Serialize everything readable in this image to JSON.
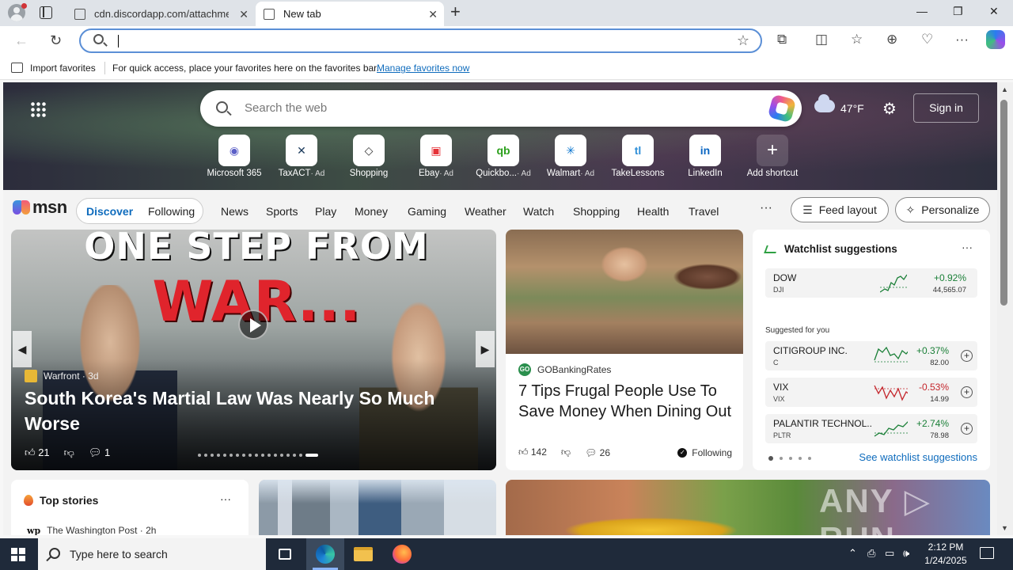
{
  "browser": {
    "tabs": [
      {
        "title": "cdn.discordapp.com/attachment"
      },
      {
        "title": "New tab"
      }
    ],
    "address": {
      "value": "",
      "placeholder": ""
    },
    "favorites_bar": {
      "import_label": "Import favorites",
      "hint": "For quick access, place your favorites here on the favorites bar.",
      "manage_link": "Manage favorites now"
    }
  },
  "newtab": {
    "search_placeholder": "Search the web",
    "weather": {
      "temp": "47°F",
      "icon": "cloud-icon"
    },
    "signin_label": "Sign in",
    "shortcuts": [
      {
        "label": "Microsoft 365",
        "ad": "",
        "glyph": "◉",
        "color": "#5b5fc7"
      },
      {
        "label": "TaxACT",
        "ad": "· Ad",
        "glyph": "✕",
        "color": "#1b3a5c"
      },
      {
        "label": "Shopping",
        "ad": "",
        "glyph": "◇",
        "color": "#333333"
      },
      {
        "label": "Ebay",
        "ad": "· Ad",
        "glyph": "▣",
        "color": "#e53238"
      },
      {
        "label": "Quickbo...",
        "ad": "· Ad",
        "glyph": "qb",
        "color": "#2ca01c"
      },
      {
        "label": "Walmart",
        "ad": "· Ad",
        "glyph": "✳",
        "color": "#0071ce"
      },
      {
        "label": "TakeLessons",
        "ad": "",
        "glyph": "tl",
        "color": "#2f8fd8"
      },
      {
        "label": "LinkedIn",
        "ad": "",
        "glyph": "in",
        "color": "#0a66c2"
      },
      {
        "label": "Add shortcut",
        "ad": "",
        "glyph": "+",
        "color": "#ffffff"
      }
    ]
  },
  "msn": {
    "logo_text": "msn",
    "feed_tabs": {
      "discover": "Discover",
      "following": "Following"
    },
    "nav": [
      "News",
      "Sports",
      "Play",
      "Money",
      "Gaming",
      "Weather",
      "Watch",
      "Shopping",
      "Health",
      "Travel"
    ],
    "more": "···",
    "feed_layout_label": "Feed layout",
    "personalize_label": "Personalize"
  },
  "hero_story": {
    "art_line1": "ONE STEP FROM",
    "art_line2": "WAR...",
    "source": "Warfront · 3d",
    "title": "South Korea's Martial Law Was Nearly So Much Worse",
    "likes": "21",
    "comments": "1",
    "dots": 18,
    "active_dot": 18
  },
  "dining_card": {
    "source": "GOBankingRates",
    "title": "7 Tips Frugal People Use To Save Money When Dining Out",
    "likes": "142",
    "comments": "26",
    "following": "Following"
  },
  "watchlist": {
    "title": "Watchlist suggestions",
    "index": {
      "name": "DOW",
      "symbol": "DJI",
      "change": "+0.92%",
      "price": "44,565.07",
      "trend": "up"
    },
    "suggested_label": "Suggested for you",
    "suggestions": [
      {
        "name": "CITIGROUP INC.",
        "symbol": "C",
        "change": "+0.37%",
        "price": "82.00",
        "trend": "up"
      },
      {
        "name": "VIX",
        "symbol": "VIX",
        "change": "-0.53%",
        "price": "14.99",
        "trend": "down"
      },
      {
        "name": "PALANTIR TECHNOL...",
        "symbol": "PLTR",
        "change": "+2.74%",
        "price": "78.98",
        "trend": "up"
      }
    ],
    "link": "See watchlist suggestions"
  },
  "top_stories": {
    "title": "Top stories",
    "source": "The Washington Post · 2h",
    "source_logo": "wp"
  },
  "watermark": "ANY ▷ RUN",
  "taskbar": {
    "search_placeholder": "Type here to search",
    "time": "2:12 PM",
    "date": "1/24/2025"
  }
}
